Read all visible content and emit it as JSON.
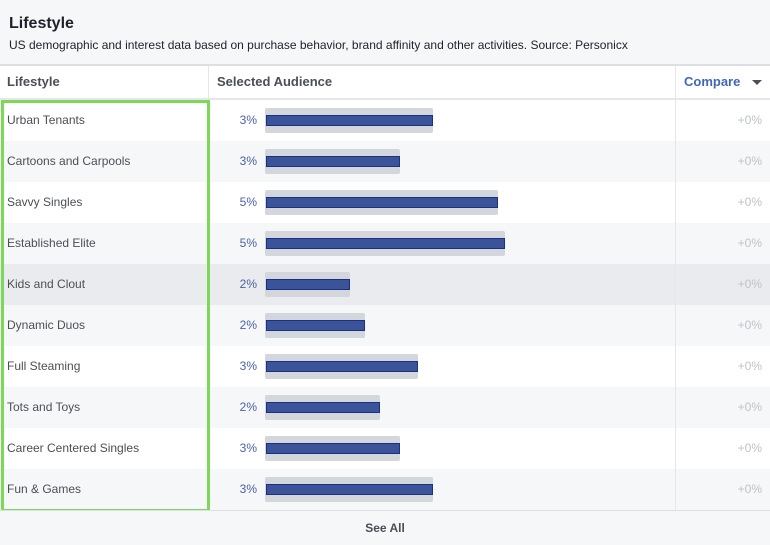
{
  "header": {
    "title": "Lifestyle",
    "subtitle": "US demographic and interest data based on purchase behavior, brand affinity and other activities. Source: Personicx"
  },
  "columns": {
    "lifestyle": "Lifestyle",
    "selected_audience": "Selected Audience",
    "compare": "Compare"
  },
  "colors": {
    "bar": "#3b5398",
    "track": "#d3d6db",
    "highlight_outline": "#7bd858",
    "accent": "#4267b2"
  },
  "rows": [
    {
      "name": "Urban Tenants",
      "pct": "3%",
      "bar_fraction": 0.67,
      "compare": "+0%"
    },
    {
      "name": "Cartoons and Carpools",
      "pct": "3%",
      "bar_fraction": 0.54,
      "compare": "+0%"
    },
    {
      "name": "Savvy Singles",
      "pct": "5%",
      "bar_fraction": 0.93,
      "compare": "+0%"
    },
    {
      "name": "Established Elite",
      "pct": "5%",
      "bar_fraction": 0.96,
      "compare": "+0%"
    },
    {
      "name": "Kids and Clout",
      "pct": "2%",
      "bar_fraction": 0.34,
      "compare": "+0%"
    },
    {
      "name": "Dynamic Duos",
      "pct": "2%",
      "bar_fraction": 0.4,
      "compare": "+0%"
    },
    {
      "name": "Full Steaming",
      "pct": "3%",
      "bar_fraction": 0.61,
      "compare": "+0%"
    },
    {
      "name": "Tots and Toys",
      "pct": "2%",
      "bar_fraction": 0.46,
      "compare": "+0%"
    },
    {
      "name": "Career Centered Singles",
      "pct": "3%",
      "bar_fraction": 0.54,
      "compare": "+0%"
    },
    {
      "name": "Fun & Games",
      "pct": "3%",
      "bar_fraction": 0.67,
      "compare": "+0%"
    }
  ],
  "highlighted_row": 4,
  "footer": {
    "see_all": "See All"
  }
}
